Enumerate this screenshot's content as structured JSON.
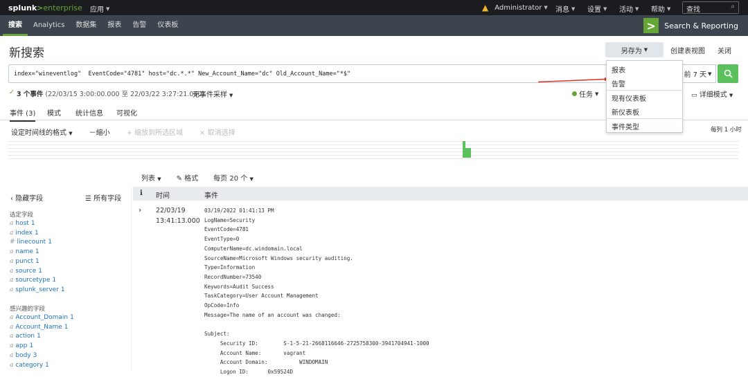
{
  "topbar": {
    "logo_main": "splunk",
    "logo_gt": ">",
    "logo_ent": "enterprise",
    "apps_menu": "应用",
    "user_menu": "Administrator",
    "messages_menu": "消息",
    "settings_menu": "设置",
    "activity_menu": "活动",
    "help_menu": "帮助",
    "find_placeholder": "查找"
  },
  "nav": {
    "items": [
      "搜索",
      "Analytics",
      "数据集",
      "报表",
      "告警",
      "仪表板"
    ],
    "app_name": "Search & Reporting",
    "app_mark": ">"
  },
  "page": {
    "title": "新搜索",
    "save_as": "另存为",
    "create_dashboard": "创建表视图",
    "close": "关闭"
  },
  "search": {
    "query": "index=\"wineventlog\"  EventCode=\"4781\" host=\"dc.*.*\" New_Account_Name=\"dc\" Old_Account_Name=\"*$\"",
    "time_range": "前 7 天"
  },
  "status": {
    "check": "✓",
    "count_label": "3 个事件",
    "range": "(22/03/15 3:00:00.000 至 22/03/22 3:27:21.000)",
    "sampling": "无事件采样",
    "jobs": "任务",
    "verbose": "详细模式"
  },
  "tabs": [
    "事件 (3)",
    "模式",
    "统计信息",
    "可视化"
  ],
  "timeline_toolbar": {
    "format": "设定时间线的格式",
    "zoom_out": "－缩小",
    "zoom_in": "+ 缩放到所选区域",
    "deselect": "× 取消选择",
    "scale": "每列 1 小时"
  },
  "results_toolbar": {
    "list": "列表",
    "format": "格式",
    "per_page": "每页 20 个"
  },
  "sidebar": {
    "hide": "‹ 隐藏字段",
    "all": "☰ 所有字段",
    "selected_label": "选定字段",
    "interesting_label": "感兴趣的字段",
    "selected": [
      {
        "type": "a",
        "name": "host",
        "count": "1"
      },
      {
        "type": "a",
        "name": "index",
        "count": "1"
      },
      {
        "type": "#",
        "name": "linecount",
        "count": "1"
      },
      {
        "type": "a",
        "name": "name",
        "count": "1"
      },
      {
        "type": "a",
        "name": "punct",
        "count": "1"
      },
      {
        "type": "a",
        "name": "source",
        "count": "1"
      },
      {
        "type": "a",
        "name": "sourcetype",
        "count": "1"
      },
      {
        "type": "a",
        "name": "splunk_server",
        "count": "1"
      }
    ],
    "interesting": [
      {
        "type": "a",
        "name": "Account_Domain",
        "count": "1"
      },
      {
        "type": "a",
        "name": "Account_Name",
        "count": "1"
      },
      {
        "type": "a",
        "name": "action",
        "count": "1"
      },
      {
        "type": "a",
        "name": "app",
        "count": "1"
      },
      {
        "type": "a",
        "name": "body",
        "count": "3"
      },
      {
        "type": "a",
        "name": "category",
        "count": "1"
      }
    ]
  },
  "table": {
    "col_info": "i",
    "col_time": "时间",
    "col_event": "事件"
  },
  "row": {
    "expand": "›",
    "date": "22/03/19",
    "time": "13:41:13.000",
    "event": "03/19/2022 01:41:13 PM\nLogName=Security\nEventCode=4781\nEventType=0\nComputerName=dc.windomain.local\nSourceName=Microsoft Windows security auditing.\nType=Information\nRecordNumber=73540\nKeywords=Audit Success\nTaskCategory=User Account Management\nOpCode=Info\nMessage=The name of an account was changed:\n\nSubject:\n\tSecurity ID:\t\tS-1-5-21-2668116646-2725758300-3941704941-1000\n\tAccount Name:\t\tvagrant\n\tAccount Domain:\t\tWINDOMAIN\n\tLogon ID:\t\t0x59524D"
  },
  "dropdown": {
    "items": [
      "报表",
      "告警",
      "现有仪表板",
      "新仪表板",
      "事件类型"
    ]
  },
  "colors": {
    "accent": "#65a637",
    "topbar": "#1a1c20",
    "navbar": "#3c444d",
    "arrow": "#e03020"
  }
}
